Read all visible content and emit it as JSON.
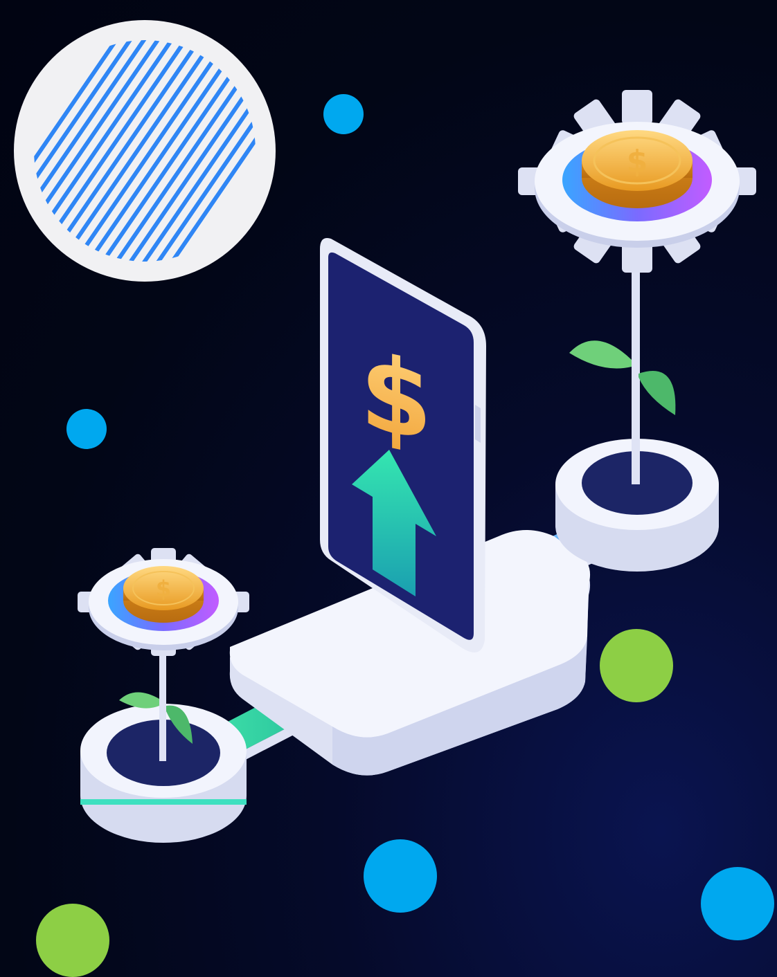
{
  "illustration": {
    "phone_symbol": "$",
    "coin_symbol": "$",
    "colors": {
      "background": "#020616",
      "dot_blue": "#00a8ef",
      "dot_green": "#8dcf45",
      "stripe_blue": "#2f86f5",
      "platform_white": "#eef0fb",
      "screen_navy": "#1c2270",
      "arrow_green": "#2fd9a6",
      "coin_gold": "#f6b53d",
      "leaf_green": "#5cc46c"
    },
    "icons": [
      "striped-circle-icon",
      "phone-icon",
      "dollar-sign-icon",
      "up-arrow-icon",
      "gear-icon",
      "coin-icon",
      "sprout-icon"
    ]
  }
}
